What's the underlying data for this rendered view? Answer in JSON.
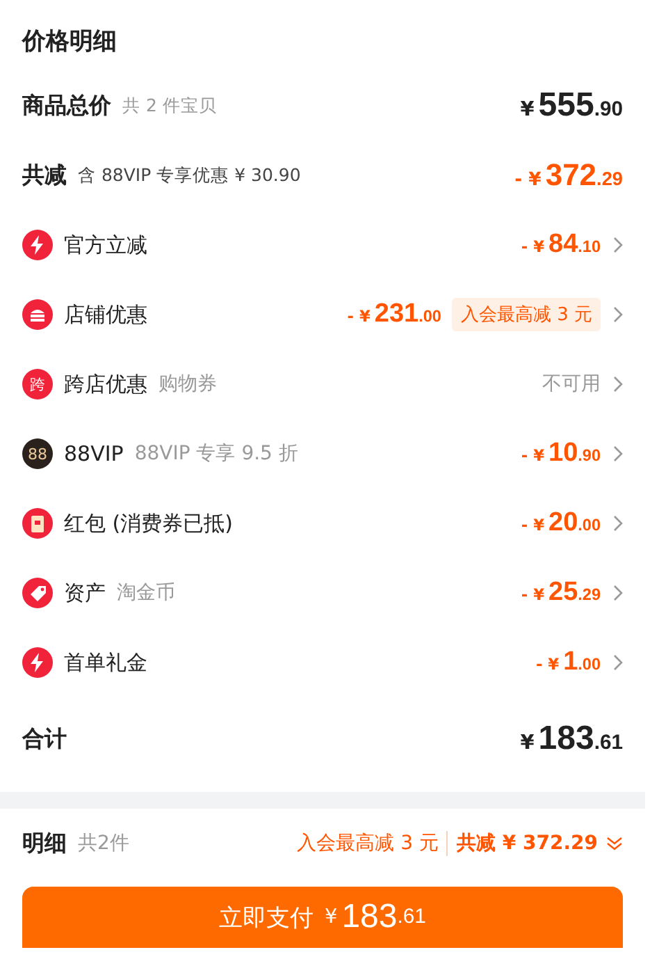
{
  "title": "价格明细",
  "total": {
    "label": "商品总价",
    "note": "共 2 件宝贝",
    "price": {
      "sign": "¥",
      "int": "555",
      "dec": ".90"
    }
  },
  "reduction": {
    "label": "共减",
    "note": "含 88VIP 专享优惠 ¥ 30.90",
    "price": {
      "sign": "- ¥",
      "int": "372",
      "dec": ".29"
    }
  },
  "items": [
    {
      "kind": "bolt",
      "label": "官方立减",
      "price": {
        "sign": "- ¥",
        "int": "84",
        "dec": ".10"
      }
    },
    {
      "kind": "shop",
      "label": "店铺优惠",
      "price": {
        "sign": "- ¥",
        "int": "231",
        "dec": ".00"
      },
      "tag": "入会最高减 3 元"
    },
    {
      "kind": "text",
      "icon_text": "跨",
      "label": "跨店优惠",
      "note": "购物券",
      "status": "不可用"
    },
    {
      "kind": "vip",
      "icon_text": "88",
      "label": "88VIP",
      "note": "88VIP 专享 9.5 折",
      "price": {
        "sign": "- ¥",
        "int": "10",
        "dec": ".90"
      }
    },
    {
      "kind": "packet",
      "label": "红包 (消费券已抵)",
      "price": {
        "sign": "- ¥",
        "int": "20",
        "dec": ".00"
      }
    },
    {
      "kind": "tag",
      "label": "资产",
      "note": "淘金币",
      "price": {
        "sign": "- ¥",
        "int": "25",
        "dec": ".29"
      }
    },
    {
      "kind": "bolt",
      "label": "首单礼金",
      "price": {
        "sign": "- ¥",
        "int": "1",
        "dec": ".00"
      }
    }
  ],
  "sum": {
    "label": "合计",
    "price": {
      "sign": "¥",
      "int": "183",
      "dec": ".61"
    }
  },
  "footer": {
    "label": "明细",
    "count": "共2件",
    "promo": "入会最高减 3 元",
    "saving": "共减 ¥ 372.29"
  },
  "pay_button": {
    "label": "立即支付",
    "price": {
      "sign": "¥",
      "int": "183",
      "dec": ".61"
    }
  }
}
